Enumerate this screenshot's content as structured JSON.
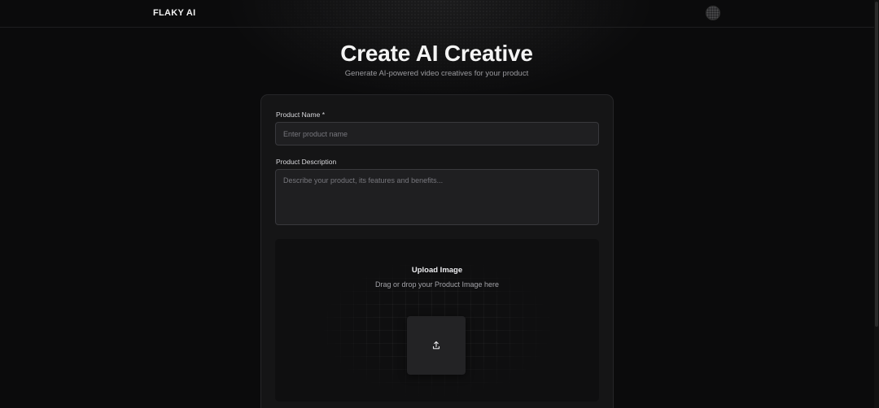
{
  "header": {
    "logo": "FLAKY AI"
  },
  "main": {
    "title": "Create AI Creative",
    "subtitle": "Generate AI-powered video creatives for your product"
  },
  "form": {
    "product_name": {
      "label": "Product Name *",
      "placeholder": "Enter product name",
      "value": ""
    },
    "product_description": {
      "label": "Product Description",
      "placeholder": "Describe your product, its features and benefits...",
      "value": ""
    },
    "upload": {
      "title": "Upload Image",
      "subtitle": "Drag or drop your Product Image here",
      "icon": "upload-icon"
    }
  },
  "colors": {
    "background": "#0b0b0c",
    "card": "#151516",
    "input": "#1f1f21",
    "text": "#ffffff",
    "muted": "#9a9a9e"
  }
}
